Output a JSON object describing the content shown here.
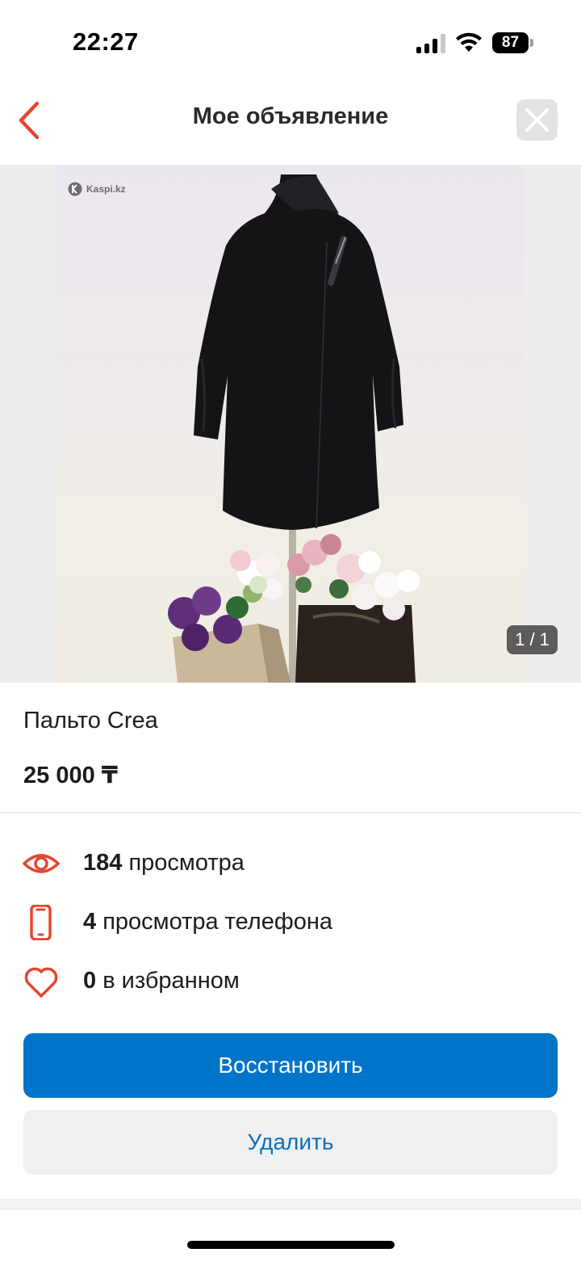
{
  "status_bar": {
    "time": "22:27",
    "battery": "87"
  },
  "nav": {
    "title": "Мое объявление",
    "back_icon": "chevron-left-icon",
    "close_icon": "close-icon",
    "accent_color": "#e4462e"
  },
  "gallery": {
    "watermark": "Kaspi.kz",
    "counter": "1 / 1"
  },
  "listing": {
    "title": "Пальто Crea",
    "price": "25 000 ₸"
  },
  "stats": [
    {
      "icon": "eye-icon",
      "count": "184",
      "label": "просмотра"
    },
    {
      "icon": "phone-icon",
      "count": "4",
      "label": "просмотра телефона"
    },
    {
      "icon": "heart-icon",
      "count": "0",
      "label": "в избранном"
    }
  ],
  "actions": {
    "restore": "Восстановить",
    "delete": "Удалить",
    "primary_color": "#0074c8"
  }
}
